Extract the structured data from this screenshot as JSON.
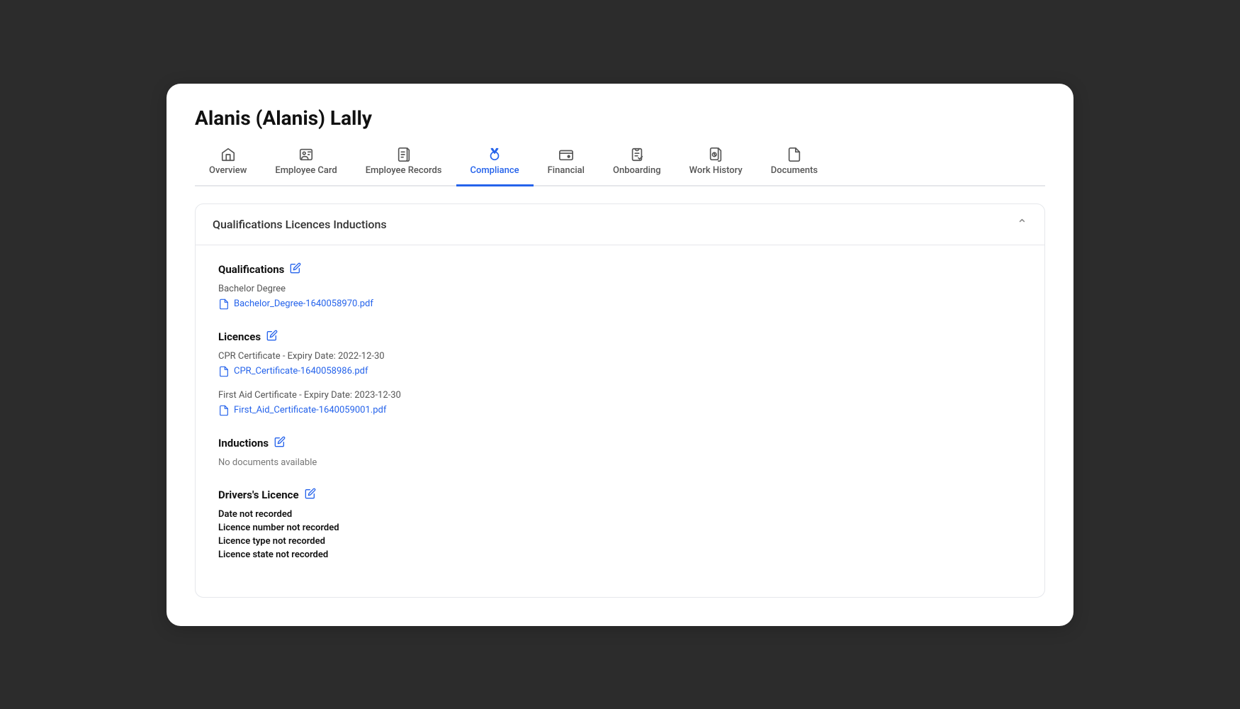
{
  "page": {
    "title": "Alanis (Alanis) Lally"
  },
  "tabs": [
    {
      "id": "overview",
      "label": "Overview",
      "icon": "home",
      "active": false
    },
    {
      "id": "employee-card",
      "label": "Employee Card",
      "icon": "id-card",
      "active": false
    },
    {
      "id": "employee-records",
      "label": "Employee Records",
      "icon": "file-list",
      "active": false
    },
    {
      "id": "compliance",
      "label": "Compliance",
      "icon": "medal",
      "active": true
    },
    {
      "id": "financial",
      "label": "Financial",
      "icon": "wallet",
      "active": false
    },
    {
      "id": "onboarding",
      "label": "Onboarding",
      "icon": "clipboard",
      "active": false
    },
    {
      "id": "work-history",
      "label": "Work History",
      "icon": "clock-file",
      "active": false
    },
    {
      "id": "documents",
      "label": "Documents",
      "icon": "document",
      "active": false
    }
  ],
  "section": {
    "header": "Qualifications Licences Inductions",
    "qualifications": {
      "title": "Qualifications",
      "items": [
        {
          "type_label": "Bachelor Degree",
          "file_name": "Bachelor_Degree-1640058970.pdf"
        }
      ]
    },
    "licences": {
      "title": "Licences",
      "items": [
        {
          "type_label": "CPR Certificate - Expiry Date: 2022-12-30",
          "file_name": "CPR_Certificate-1640058986.pdf"
        },
        {
          "type_label": "First Aid Certificate - Expiry Date: 2023-12-30",
          "file_name": "First_Aid_Certificate-1640059001.pdf"
        }
      ]
    },
    "inductions": {
      "title": "Inductions",
      "no_docs_label": "No documents available"
    },
    "drivers_licence": {
      "title": "Drivers's Licence",
      "fields": [
        "Date not recorded",
        "Licence number not recorded",
        "Licence type not recorded",
        "Licence state not recorded"
      ]
    }
  }
}
